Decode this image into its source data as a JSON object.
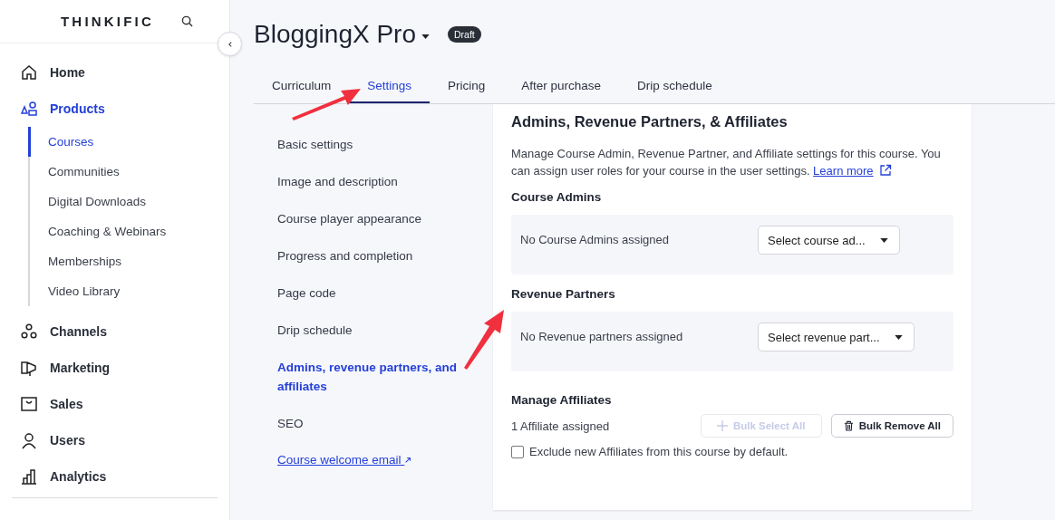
{
  "sidebar": {
    "logo": "THINKIFIC",
    "items": [
      {
        "label": "Home",
        "selected": false
      },
      {
        "label": "Products",
        "selected": true,
        "children": [
          {
            "label": "Courses",
            "selected": true
          },
          {
            "label": "Communities",
            "selected": false
          },
          {
            "label": "Digital Downloads",
            "selected": false
          },
          {
            "label": "Coaching & Webinars",
            "selected": false
          },
          {
            "label": "Memberships",
            "selected": false
          },
          {
            "label": "Video Library",
            "selected": false
          }
        ]
      },
      {
        "label": "Channels",
        "selected": false
      },
      {
        "label": "Marketing",
        "selected": false
      },
      {
        "label": "Sales",
        "selected": false
      },
      {
        "label": "Users",
        "selected": false
      },
      {
        "label": "Analytics",
        "selected": false
      }
    ]
  },
  "header": {
    "title": "BloggingX Pro",
    "badge": "Draft"
  },
  "tabs": [
    {
      "label": "Curriculum",
      "selected": false
    },
    {
      "label": "Settings",
      "selected": true
    },
    {
      "label": "Pricing",
      "selected": false
    },
    {
      "label": "After purchase",
      "selected": false
    },
    {
      "label": "Drip schedule",
      "selected": false
    }
  ],
  "settings_nav": [
    {
      "label": "Basic settings",
      "selected": false,
      "kind": "item"
    },
    {
      "label": "Image and description",
      "selected": false,
      "kind": "item"
    },
    {
      "label": "Course player appearance",
      "selected": false,
      "kind": "item"
    },
    {
      "label": "Progress and completion",
      "selected": false,
      "kind": "item"
    },
    {
      "label": "Page code",
      "selected": false,
      "kind": "item"
    },
    {
      "label": "Drip schedule",
      "selected": false,
      "kind": "item"
    },
    {
      "label": "Admins, revenue partners, and affiliates",
      "selected": true,
      "kind": "item"
    },
    {
      "label": "SEO",
      "selected": false,
      "kind": "item"
    },
    {
      "label": "Course welcome email",
      "kind": "external-link"
    }
  ],
  "panel": {
    "title": "Admins, Revenue Partners, & Affiliates",
    "description": "Manage Course Admin, Revenue Partner, and Affiliate settings for this course. You can assign user roles for your course in the user settings.",
    "learn_more": "Learn more",
    "sections": [
      {
        "title": "Course Admins",
        "empty_text": "No Course Admins assigned",
        "select": "Select course ad..."
      },
      {
        "title": "Revenue Partners",
        "empty_text": "No Revenue partners assigned",
        "select": "Select revenue part..."
      }
    ],
    "affiliates": {
      "title": "Manage Affiliates",
      "count": "1 Affiliate assigned",
      "buttons": [
        {
          "label": "Bulk Select All",
          "disabled": true
        },
        {
          "label": "Bulk Remove All",
          "disabled": false
        }
      ],
      "checkbox": {
        "label": "Exclude new Affiliates from this course by default.",
        "checked": false
      }
    }
  }
}
